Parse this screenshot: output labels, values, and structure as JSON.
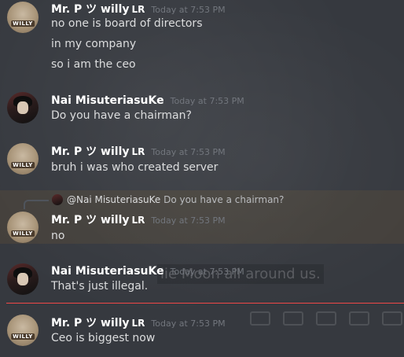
{
  "messages": [
    {
      "author": "Mr. P ツ willy",
      "badge": "LR",
      "timestamp": "Today at 7:53 PM",
      "avatar": "willy-cat-avatar",
      "lines": [
        "no one is board of directors",
        "in my company",
        "so i am the ceo"
      ]
    },
    {
      "author": "Nai MisuteriasuKe",
      "badge": "",
      "timestamp": "Today at 7:53 PM",
      "avatar": "anime-character-avatar",
      "lines": [
        "Do you have a chairman?"
      ]
    },
    {
      "author": "Mr. P ツ willy",
      "badge": "LR",
      "timestamp": "Today at 7:53 PM",
      "avatar": "willy-cat-avatar",
      "lines": [
        "bruh i was who created server"
      ]
    },
    {
      "reply": {
        "mention": "@Nai MisuteriasuKe",
        "quoted": "Do you have a chairman?"
      },
      "author": "Mr. P ツ willy",
      "badge": "LR",
      "timestamp": "Today at 7:53 PM",
      "avatar": "willy-cat-avatar",
      "lines": [
        "no"
      ]
    },
    {
      "author": "Nai MisuteriasuKe",
      "badge": "",
      "timestamp": "Today at 7:53 PM",
      "avatar": "anime-character-avatar",
      "lines": [
        "That's just illegal."
      ]
    },
    {
      "author": "Mr. P ツ willy",
      "badge": "LR",
      "timestamp": "Today at 7:53 PM",
      "avatar": "willy-cat-avatar",
      "lines": [
        "Ceo is biggest now"
      ]
    }
  ],
  "avatar_tag": "WILLY",
  "background_caption": "lie Moon all around us.",
  "colors": {
    "background": "#36393f",
    "name": "#ffffff",
    "text": "#dcddde",
    "timestamp": "#72767d",
    "new_divider": "#f04747"
  }
}
